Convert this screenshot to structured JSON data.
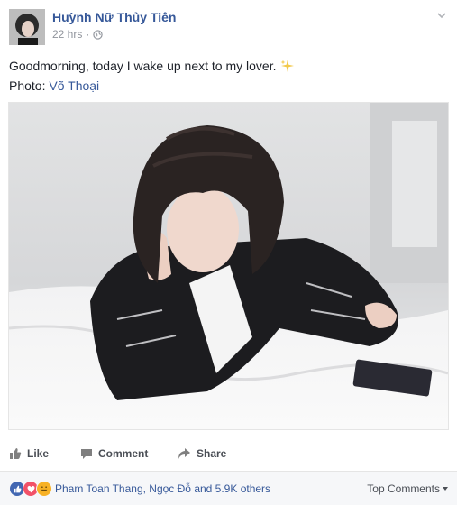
{
  "author": {
    "name": "Huỳnh Nữ Thủy Tiên"
  },
  "meta": {
    "time": "22 hrs",
    "separator": "·",
    "privacy_icon": "globe-icon"
  },
  "post": {
    "text": "Goodmorning, today I wake up next to my lover.",
    "emoji_icon": "sparkles-icon",
    "credit_prefix": "Photo: ",
    "credit_name": "Võ Thoại"
  },
  "actions": {
    "like": "Like",
    "comment": "Comment",
    "share": "Share"
  },
  "reactions": {
    "icons": [
      "like-icon",
      "love-icon",
      "haha-icon"
    ],
    "summary": "Pham Toan Thang, Ngọc Đỗ and 5.9K others",
    "sort_label": "Top Comments"
  },
  "colors": {
    "link": "#365899",
    "meta": "#90949c",
    "action": "#4b4f56",
    "like": "#4267b2",
    "love": "#f25268",
    "haha": "#f7b125"
  }
}
